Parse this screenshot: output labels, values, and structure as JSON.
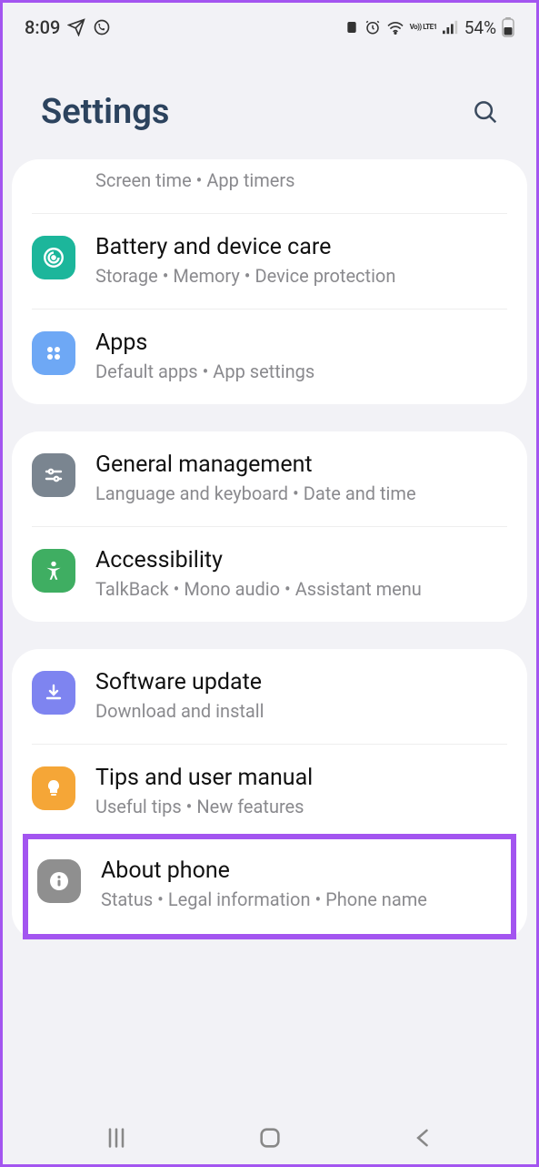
{
  "status": {
    "time": "8:09",
    "battery": "54%",
    "lte": "Vo)) LTE1"
  },
  "header": {
    "title": "Settings"
  },
  "groups": [
    {
      "items": [
        {
          "title": "",
          "sub": "Screen time  •  App timers",
          "partial": true,
          "iconColor": "",
          "iconName": ""
        },
        {
          "title": "Battery and device care",
          "sub": "Storage  •  Memory  •  Device protection",
          "iconColor": "#1cb69b",
          "iconName": "battery-care-icon"
        },
        {
          "title": "Apps",
          "sub": "Default apps  •  App settings",
          "iconColor": "#6ea8f5",
          "iconName": "apps-icon"
        }
      ]
    },
    {
      "items": [
        {
          "title": "General management",
          "sub": "Language and keyboard  •  Date and time",
          "iconColor": "#7a8590",
          "iconName": "general-management-icon"
        },
        {
          "title": "Accessibility",
          "sub": "TalkBack  •  Mono audio  •  Assistant menu",
          "iconColor": "#3fae62",
          "iconName": "accessibility-icon"
        }
      ]
    },
    {
      "items": [
        {
          "title": "Software update",
          "sub": "Download and install",
          "iconColor": "#7e84f0",
          "iconName": "software-update-icon"
        },
        {
          "title": "Tips and user manual",
          "sub": "Useful tips  •  New features",
          "iconColor": "#f5a637",
          "iconName": "tips-icon"
        },
        {
          "title": "About phone",
          "sub": "Status  •  Legal information  •  Phone name",
          "iconColor": "#8f8f8f",
          "iconName": "about-phone-icon",
          "highlighted": true
        }
      ]
    }
  ]
}
